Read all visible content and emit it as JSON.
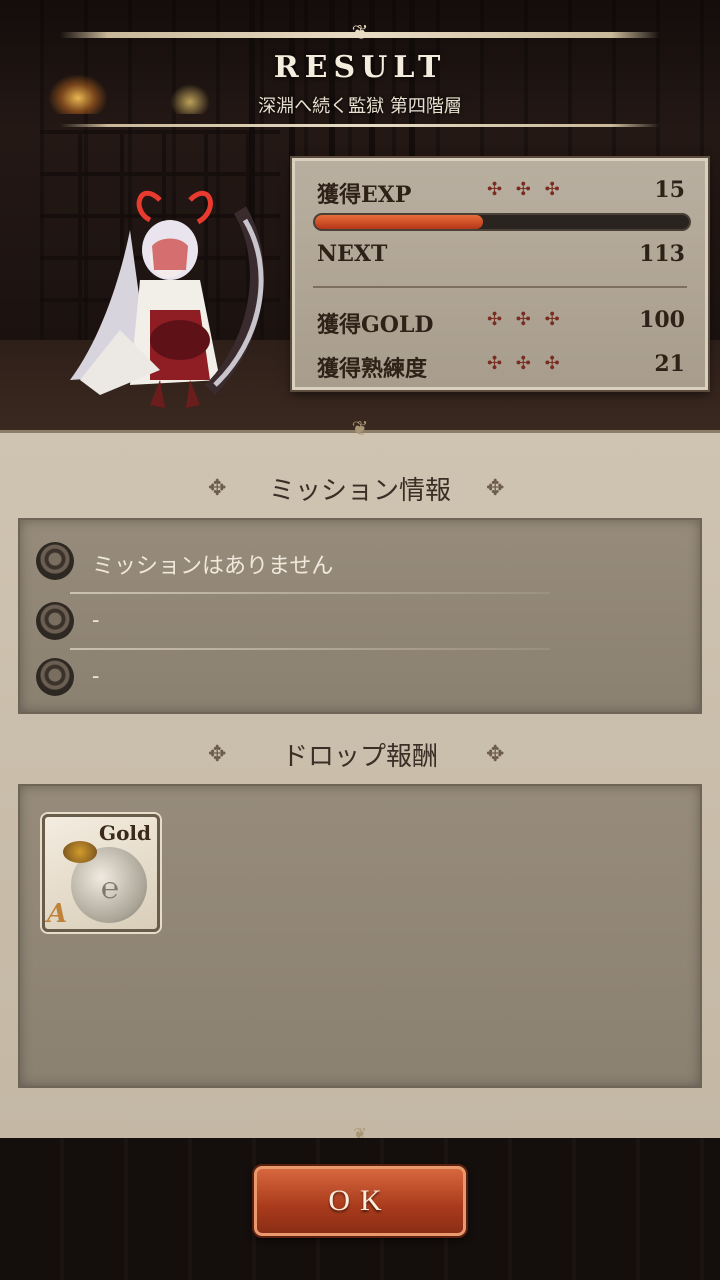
{
  "header": {
    "title": "RESULT",
    "stage": "深淵へ続く監獄 第四階層"
  },
  "stats": {
    "exp_label": "獲得EXP",
    "exp_value": "15",
    "exp_progress": 0.45,
    "next_label": "NEXT",
    "next_value": "113",
    "gold_label": "獲得GOLD",
    "gold_value": "100",
    "mastery_label": "獲得熟練度",
    "mastery_value": "21",
    "plus_mark": "✣ ✣ ✣"
  },
  "mission": {
    "title": "ミッション情報",
    "items": [
      "ミッションはありません",
      "-",
      "-"
    ]
  },
  "drop": {
    "title": "ドロップ報酬",
    "items": [
      {
        "name": "Gold",
        "rank": "A",
        "icon": "gold-bag-icon"
      }
    ]
  },
  "ok_label": "OK",
  "colors": {
    "accent": "#b53618",
    "parchment": "#cfc3b1",
    "panel": "#8b8171"
  }
}
